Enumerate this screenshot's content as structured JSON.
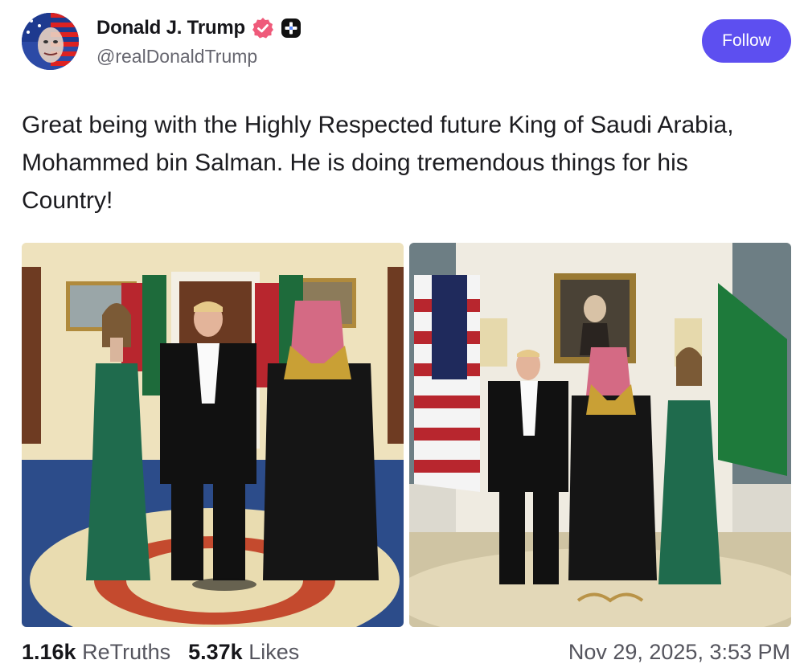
{
  "author": {
    "display_name": "Donald J. Trump",
    "handle": "@realDonaldTrump",
    "verified_icon": "verified-badge-icon",
    "extra_badge_icon": "plus-badge-icon"
  },
  "follow_label": "Follow",
  "post": {
    "text": "Great being with the Highly Respected future King of Saudi Arabia, Mohammed bin Salman. He is doing tremendous things for his Country!"
  },
  "media": [
    {
      "icon": "photo-image"
    },
    {
      "icon": "photo-image"
    }
  ],
  "stats": {
    "retruths_count": "1.16k",
    "retruths_label": "ReTruths",
    "likes_count": "5.37k",
    "likes_label": "Likes"
  },
  "timestamp": "Nov 29, 2025, 3:53 PM",
  "colors": {
    "accent": "#5d4ff0",
    "verified": "#ef5a7a"
  }
}
